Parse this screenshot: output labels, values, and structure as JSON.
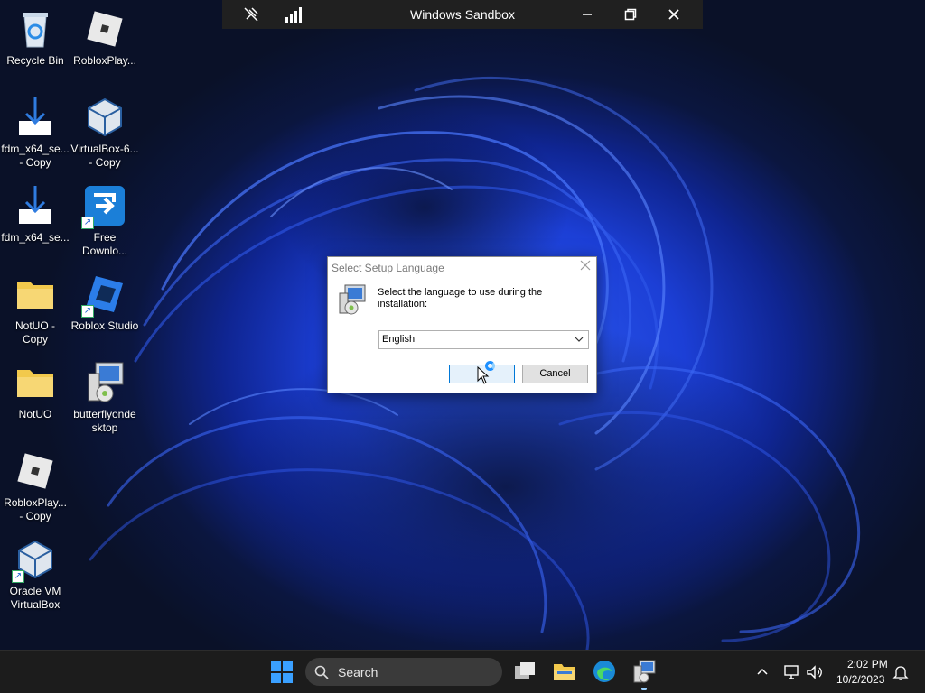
{
  "sandbox": {
    "title": "Windows Sandbox"
  },
  "desktop_icons": [
    {
      "label": "Recycle Bin"
    },
    {
      "label": "RobloxPlay..."
    },
    {
      "label": "fdm_x64_se...\n- Copy"
    },
    {
      "label": "VirtualBox-6...\n- Copy"
    },
    {
      "label": "fdm_x64_se..."
    },
    {
      "label": "Free\nDownlo..."
    },
    {
      "label": "NotUO -\nCopy"
    },
    {
      "label": "Roblox Studio"
    },
    {
      "label": "NotUO"
    },
    {
      "label": "butterflyonde\nsktop"
    },
    {
      "label": "RobloxPlay...\n- Copy"
    },
    {
      "label": "Oracle VM\nVirtualBox"
    }
  ],
  "dialog": {
    "title": "Select Setup Language",
    "message": "Select the language to use during the installation:",
    "selected_language": "English",
    "ok_label": "",
    "cancel_label": "Cancel"
  },
  "taskbar": {
    "search_label": "Search",
    "time": "2:02 PM",
    "date": "10/2/2023"
  },
  "colors": {
    "accent": "#0078d7",
    "wallpaper_blue": "#1c3fd6",
    "taskbar_bg": "#1c1c1c"
  },
  "icons": [
    "pin-off-icon",
    "signal-icon",
    "minimize-icon",
    "restore-icon",
    "close-icon",
    "windows-start-icon",
    "search-icon",
    "task-view-icon",
    "file-explorer-icon",
    "edge-icon",
    "setup-app-icon",
    "chevron-up-icon",
    "network-icon",
    "volume-icon",
    "notification-bell-icon"
  ]
}
